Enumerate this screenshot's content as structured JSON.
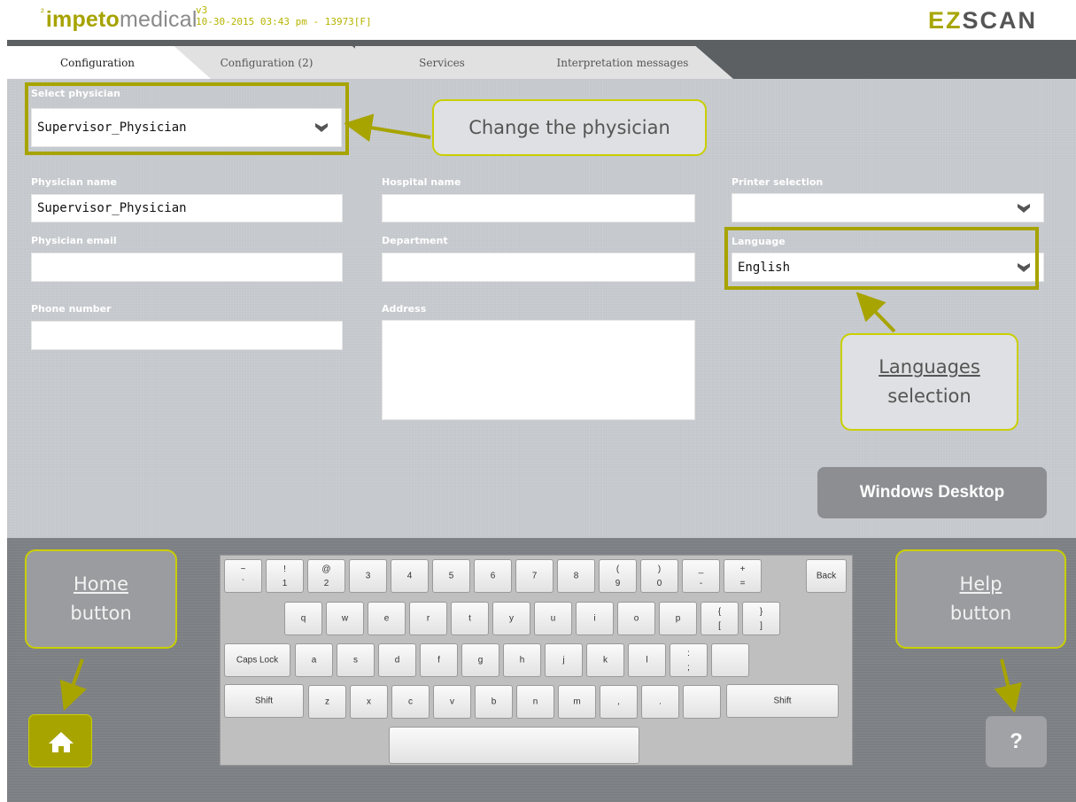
{
  "header": {
    "logo_reg": "²",
    "logo_bold": "impeto",
    "logo_rest": "medical",
    "version": "v3",
    "datetime": "10-30-2015 03:43 pm - 13973[F]",
    "brand_a": "EZ",
    "brand_b": "SCAN"
  },
  "tabs": [
    {
      "label": "Configuration",
      "active": true
    },
    {
      "label": "Configuration (2)",
      "active": false
    },
    {
      "label": "Services",
      "active": false
    },
    {
      "label": "Interpretation messages",
      "active": false
    }
  ],
  "form": {
    "select_physician_label": "Select physician",
    "select_physician_value": "Supervisor_Physician",
    "physician_name_label": "Physician name",
    "physician_name_value": "Supervisor_Physician",
    "physician_email_label": "Physician email",
    "physician_email_value": "",
    "phone_label": "Phone number",
    "phone_value": "",
    "hospital_label": "Hospital name",
    "hospital_value": "",
    "department_label": "Department",
    "department_value": "",
    "address_label": "Address",
    "address_value": "",
    "printer_label": "Printer selection",
    "printer_value": "",
    "language_label": "Language",
    "language_value": "English"
  },
  "callouts": {
    "change_physician": "Change the physician",
    "languages_a": "Languages",
    "languages_b": "selection",
    "home_a": "Home",
    "home_b": "button",
    "help_a": "Help",
    "help_b": "button"
  },
  "buttons": {
    "windows_desktop": "Windows Desktop",
    "help": "?"
  },
  "keyboard": {
    "row1": [
      [
        "~",
        "`"
      ],
      [
        "!",
        "1"
      ],
      [
        "@",
        "2"
      ],
      [
        "",
        "3"
      ],
      [
        "",
        "4"
      ],
      [
        "",
        "5"
      ],
      [
        "",
        "6"
      ],
      [
        "",
        "7"
      ],
      [
        "",
        "8"
      ],
      [
        "(",
        "9"
      ],
      [
        ")",
        "0"
      ],
      [
        "_",
        "-"
      ],
      [
        "+",
        "="
      ]
    ],
    "back": "Back",
    "row2": [
      "q",
      "w",
      "e",
      "r",
      "t",
      "y",
      "u",
      "i",
      "o",
      "p"
    ],
    "row2_extra": [
      [
        "{",
        "["
      ],
      [
        "}",
        "]"
      ]
    ],
    "caps": "Caps Lock",
    "row3": [
      "a",
      "s",
      "d",
      "f",
      "g",
      "h",
      "j",
      "k",
      "l"
    ],
    "row3_extra": [
      [
        ":",
        ";"
      ]
    ],
    "shift": "Shift",
    "row4": [
      "z",
      "x",
      "c",
      "v",
      "b",
      "n",
      "m",
      ",",
      "."
    ]
  },
  "colors": {
    "accent": "#a7a400",
    "callout_border": "#c9cf00",
    "tabbar": "#5c6063",
    "panel": "#c4c7cb",
    "bottom": "#7c7f83"
  }
}
